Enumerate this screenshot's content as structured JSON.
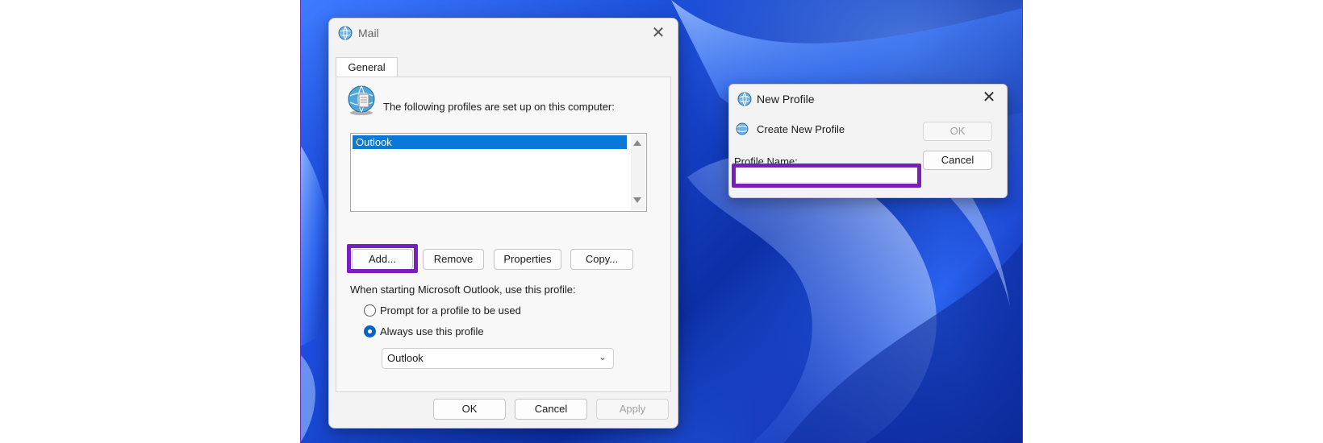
{
  "mail_dialog": {
    "title": "Mail",
    "tab_general": "General",
    "profiles_label": "The following profiles are set up on this computer:",
    "profiles": [
      "Outlook"
    ],
    "buttons": {
      "add": "Add...",
      "remove": "Remove",
      "properties": "Properties",
      "copy": "Copy...",
      "ok": "OK",
      "cancel": "Cancel",
      "apply": "Apply"
    },
    "startup_label": "When starting Microsoft Outlook, use this profile:",
    "radio_prompt": "Prompt for a profile to be used",
    "radio_always": "Always use this profile",
    "selected_radio": "always",
    "profile_select_value": "Outlook"
  },
  "new_profile_dialog": {
    "title": "New Profile",
    "create_label": "Create New Profile",
    "profile_name_label": "Profile Name:",
    "profile_name_value": "",
    "ok": "OK",
    "cancel": "Cancel"
  },
  "highlight_color": "#7a1fbf",
  "icons": [
    "mail-globe-icon",
    "profiles-globe-icon",
    "close-icon",
    "chevron-down-icon",
    "scroll-up-arrow-icon",
    "scroll-down-arrow-icon"
  ]
}
